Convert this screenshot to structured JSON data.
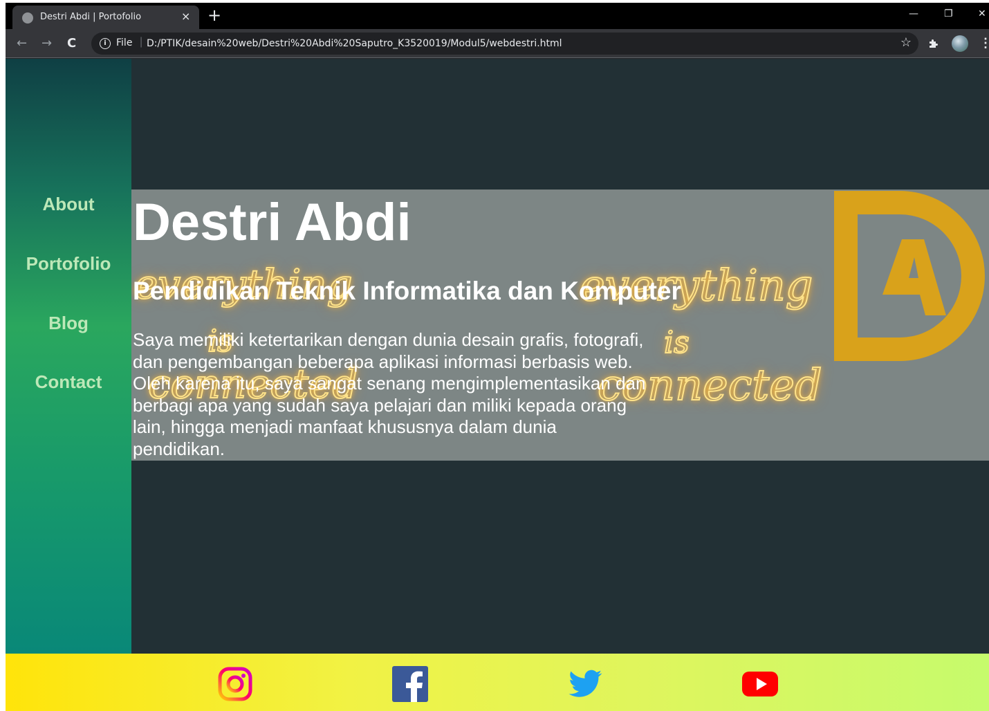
{
  "browser": {
    "tab_title": "Destri Abdi | Portofolio",
    "tab_close": "×",
    "new_tab": "+",
    "file_label": "File",
    "url": "D:/PTIK/desain%20web/Destri%20Abdi%20Saputro_K3520019/Modul5/webdestri.html",
    "controls": {
      "minimize": "—",
      "restore": "❐",
      "close": "✕"
    },
    "nav": {
      "back": "←",
      "forward": "→",
      "reload": "C"
    },
    "star": "☆",
    "menu": "⋮"
  },
  "sidebar": {
    "items": [
      {
        "label": "About"
      },
      {
        "label": "Portofolio"
      },
      {
        "label": "Blog"
      },
      {
        "label": "Contact"
      }
    ]
  },
  "hero": {
    "title": "Destri Abdi",
    "subtitle": "Pendidikan Teknik Informatika dan Komputer",
    "description": "Saya memiliki ketertarikan dengan dunia desain grafis, fotografi, dan pengembangan beberapa aplikasi informasi berbasis web. Oleh karena itu, saya sangat senang mengimplementasikan dan berbagi apa yang sudah saya pelajari dan miliki kepada orang lain, hingga menjadi manfaat khususnya dalam dunia pendidikan.",
    "neon_left": [
      "everything",
      "is",
      "connected"
    ],
    "neon_right": [
      "everything",
      "is",
      "connected"
    ],
    "logo_letters": "DA",
    "logo_color": "#d9a21b"
  },
  "footer": {
    "social": [
      {
        "icon": "instagram-icon"
      },
      {
        "icon": "facebook-icon"
      },
      {
        "icon": "twitter-icon"
      },
      {
        "icon": "youtube-icon"
      }
    ]
  },
  "colors": {
    "page_bg": "#223035",
    "hero_bg": "#7d8685",
    "nav_text": "#bde8b8"
  }
}
